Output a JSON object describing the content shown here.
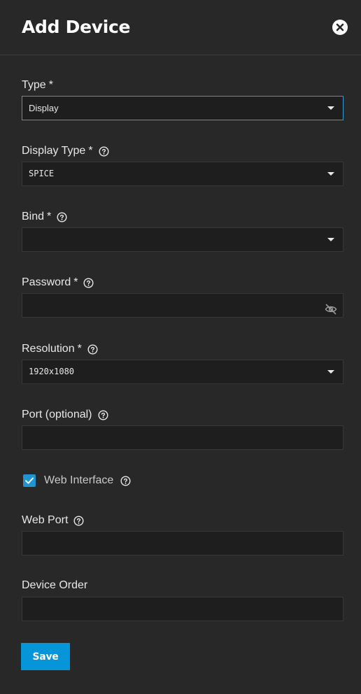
{
  "dialog": {
    "title": "Add Device"
  },
  "fields": {
    "type": {
      "label": "Type",
      "required": "*",
      "value": "Display"
    },
    "display_type": {
      "label": "Display Type",
      "required": "*",
      "value": "SPICE"
    },
    "bind": {
      "label": "Bind",
      "required": "*",
      "value": ""
    },
    "password": {
      "label": "Password",
      "required": "*",
      "value": ""
    },
    "resolution": {
      "label": "Resolution",
      "required": "*",
      "value": "1920x1080"
    },
    "port": {
      "label": "Port (optional)",
      "value": ""
    },
    "web_interface": {
      "label": "Web Interface",
      "checked": true
    },
    "web_port": {
      "label": "Web Port",
      "value": ""
    },
    "device_order": {
      "label": "Device Order",
      "value": ""
    }
  },
  "actions": {
    "save_label": "Save"
  },
  "colors": {
    "accent": "#0795d9",
    "background": "#282828",
    "input_bg": "#1e1e1e",
    "focus_border": "#2aa0d8"
  }
}
